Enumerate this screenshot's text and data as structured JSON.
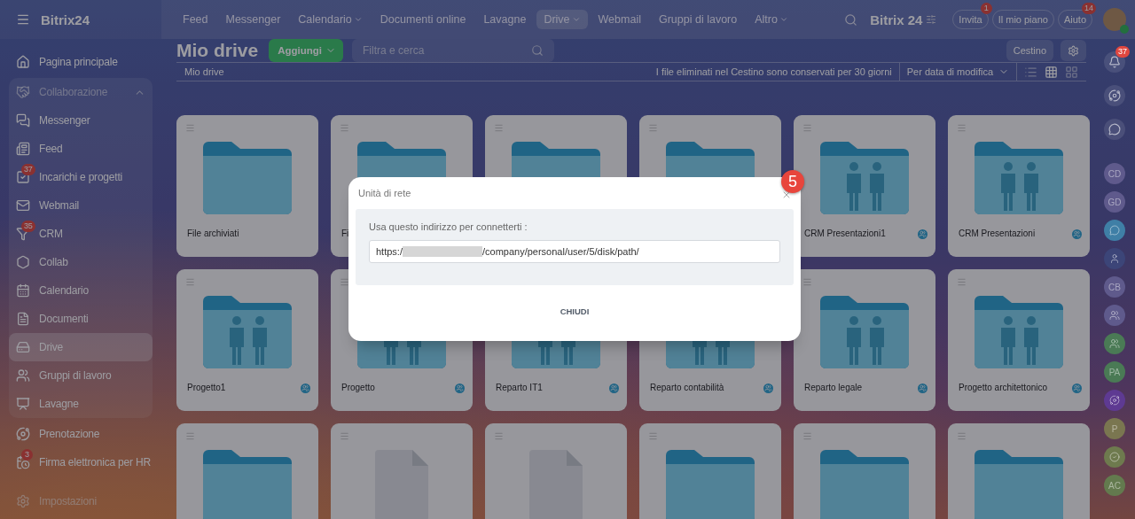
{
  "topbar": {
    "logo": "Bitrix24",
    "nav": [
      {
        "label": "Feed",
        "selected": false,
        "dropdown": false
      },
      {
        "label": "Messenger",
        "selected": false,
        "dropdown": false
      },
      {
        "label": "Calendario",
        "selected": false,
        "dropdown": true
      },
      {
        "label": "Documenti online",
        "selected": false,
        "dropdown": false
      },
      {
        "label": "Lavagne",
        "selected": false,
        "dropdown": false
      },
      {
        "label": "Drive",
        "selected": true,
        "dropdown": true
      },
      {
        "label": "Webmail",
        "selected": false,
        "dropdown": false
      },
      {
        "label": "Gruppi di lavoro",
        "selected": false,
        "dropdown": false
      },
      {
        "label": "Altro",
        "selected": false,
        "dropdown": true
      }
    ],
    "brand": "Bitrix 24",
    "buttons": [
      {
        "label": "Invita",
        "badge": "1"
      },
      {
        "label": "Il mio piano"
      },
      {
        "label": "Aiuto",
        "badge": "14"
      }
    ]
  },
  "sidebar": {
    "items": [
      {
        "label": "Pagina principale",
        "selected": false
      },
      {
        "label": "Collaborazione",
        "expanded": true,
        "children": [
          {
            "label": "Messenger",
            "selected": false
          },
          {
            "label": "Feed",
            "selected": false
          },
          {
            "label": "Incarichi e progetti",
            "selected": false,
            "badge": "37"
          },
          {
            "label": "Webmail",
            "selected": false
          },
          {
            "label": "CRM",
            "selected": false,
            "badge": "35"
          },
          {
            "label": "Collab",
            "selected": false
          },
          {
            "label": "Calendario",
            "selected": false
          },
          {
            "label": "Documenti",
            "selected": false
          },
          {
            "label": "Drive",
            "selected": true
          },
          {
            "label": "Gruppi di lavoro",
            "selected": false
          },
          {
            "label": "Lavagne",
            "selected": false
          }
        ]
      },
      {
        "label": "Prenotazione",
        "selected": false
      },
      {
        "label": "Firma elettronica per HR",
        "selected": false,
        "badge": "3"
      }
    ],
    "settings": "Impostazioni"
  },
  "main": {
    "title": "Mio drive",
    "add_button": "Aggiungi",
    "search": {
      "placeholder": "Filtra e cerca"
    },
    "trash_button": "Cestino",
    "breadcrumb": "Mio drive",
    "notice": "I file eliminati nel Cestino sono conservati per 30 giorni",
    "sort": "Per data di modifica",
    "views": [
      {
        "selected": false
      },
      {
        "selected": true
      },
      {
        "selected": false
      }
    ],
    "cards": [
      {
        "kind": "folder",
        "name": "File archiviati"
      },
      {
        "kind": "folder",
        "name": "Fi"
      },
      {
        "kind": "folder"
      },
      {
        "kind": "folder"
      },
      {
        "kind": "shared-folder",
        "name": "CRM Presentazioni1"
      },
      {
        "kind": "shared-folder",
        "name": "CRM Presentazioni"
      },
      {
        "kind": "shared-folder",
        "name": "Progetto1"
      },
      {
        "kind": "shared-folder",
        "name": "Progetto"
      },
      {
        "kind": "shared-folder",
        "name": "Reparto IT1"
      },
      {
        "kind": "shared-folder",
        "name": "Reparto contabilità"
      },
      {
        "kind": "shared-folder",
        "name": "Reparto legale"
      },
      {
        "kind": "shared-folder",
        "name": "Progetto architettonico"
      },
      {
        "kind": "folder"
      },
      {
        "kind": "file"
      },
      {
        "kind": "file"
      },
      {
        "kind": "folder"
      },
      {
        "kind": "folder"
      },
      {
        "kind": "folder"
      }
    ]
  },
  "right_rail": {
    "bell_badge": "37",
    "avatars": [
      {
        "initials": "CD",
        "color": "#5f5a8c"
      },
      {
        "initials": "GD",
        "color": "#5f5a8c"
      },
      {
        "kind": "chat",
        "color": "#3f7fa6"
      },
      {
        "kind": "photo",
        "color": "#3c4578"
      },
      {
        "initials": "CB",
        "color": "#5f5a8c"
      },
      {
        "kind": "group",
        "color": "#5f5a8c"
      },
      {
        "kind": "group",
        "color": "#4a7a55"
      },
      {
        "initials": "PA",
        "color": "#4a7a55"
      },
      {
        "kind": "swirl",
        "color": "#5e3a92"
      },
      {
        "initials": "P",
        "color": "#7a7650"
      },
      {
        "kind": "check",
        "color": "#6e7a4e"
      },
      {
        "initials": "AC",
        "color": "#637a4e"
      }
    ]
  },
  "dialog": {
    "title": "Unità di rete",
    "label": "Usa questo indirizzo per connetterti :",
    "url_start": "https:/",
    "url_redacted": true,
    "url_end": "/company/personal/user/5/disk/path/",
    "close_button": "CHIUDI",
    "marker": "5"
  }
}
